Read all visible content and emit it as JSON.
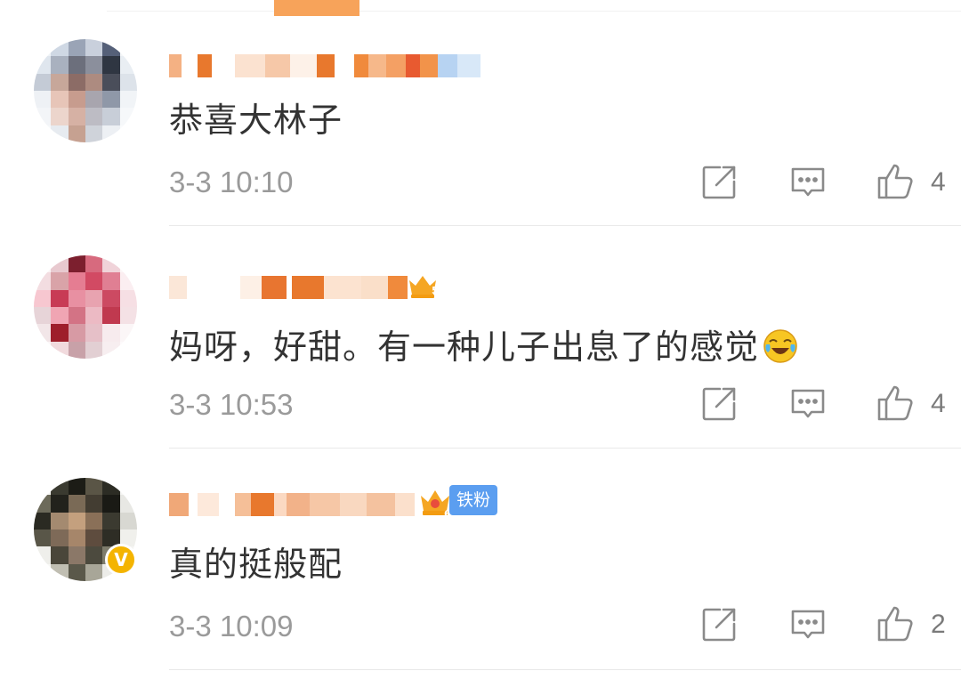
{
  "comments": [
    {
      "text": "恭喜大林子",
      "time": "3-3 10:10",
      "likes": "4",
      "badges": []
    },
    {
      "text": "妈呀，好甜。有一种儿子出息了的感觉",
      "time": "3-3 10:53",
      "likes": "4",
      "badges": [
        "crown-level-5"
      ]
    },
    {
      "text": "真的挺般配",
      "time": "3-3 10:09",
      "likes": "2",
      "badges": [
        "crown-level-6",
        "fan-badge"
      ],
      "fan_badge_label": "铁粉",
      "verified": true
    }
  ],
  "icons": {
    "share": "share-icon",
    "reply": "comment-icon",
    "like": "thumbs-up-icon",
    "emoji": "laugh-cry-emoji-icon",
    "verified": "verified-v-icon"
  },
  "colors": {
    "text": "#333333",
    "time": "#9a9a9a",
    "icon": "#8a8a8a",
    "fan_badge": "#5b9ef0",
    "crown": "#f5a623",
    "verified": "#f4b400"
  }
}
